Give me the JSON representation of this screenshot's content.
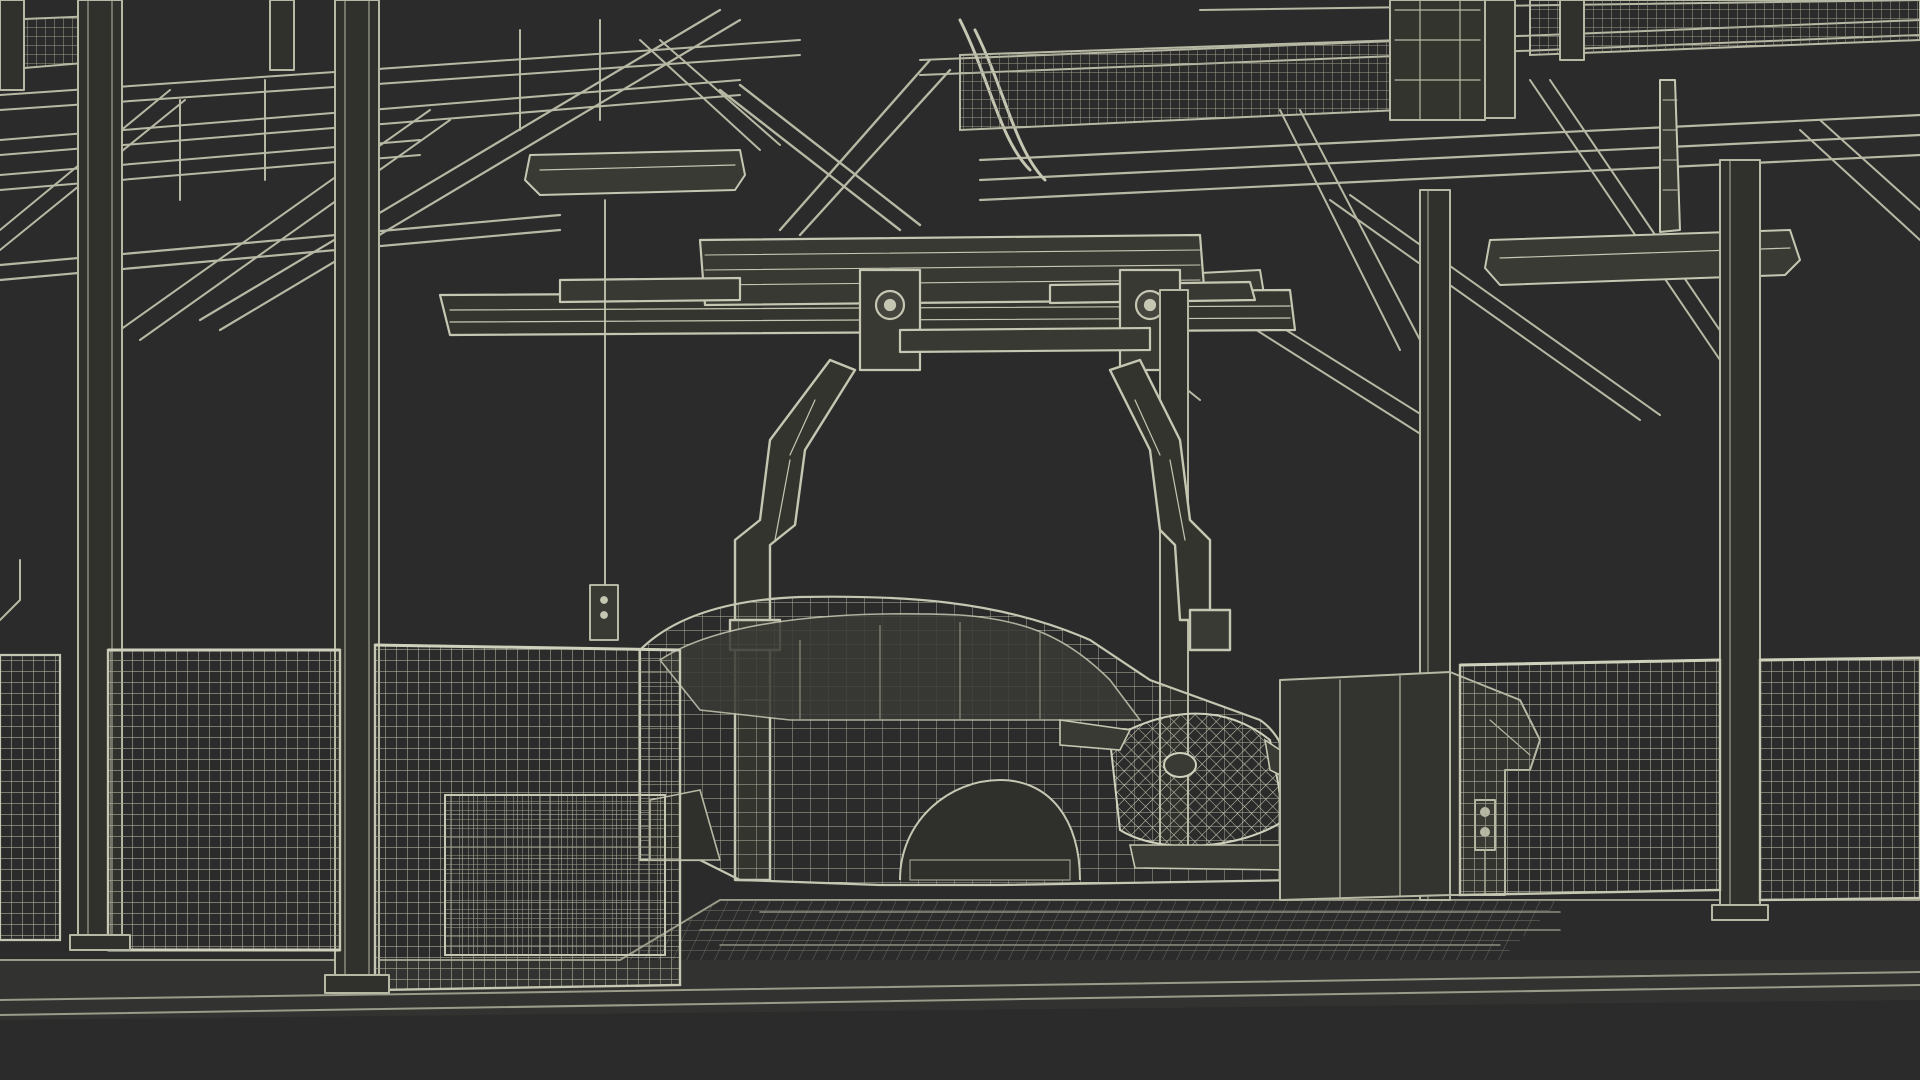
{
  "scene": {
    "background": "#2b2b2b",
    "wire_color": "#b8b9a4",
    "wire_dim": "#8e8f7f",
    "wire_bright": "#d6d6c2",
    "surface_fill": "#3a3a35"
  }
}
